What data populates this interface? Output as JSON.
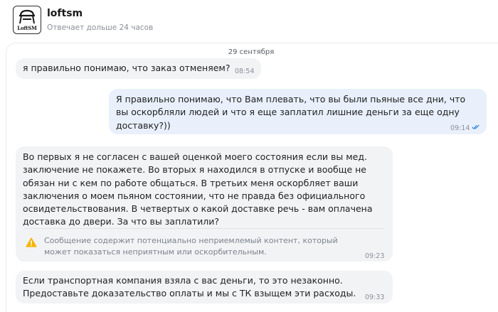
{
  "header": {
    "shop_name": "loftsm",
    "status": "Отвечает дольше 24 часов",
    "avatar_text": "LoftSM",
    "avatar_icon": "chair-icon"
  },
  "chat": {
    "date_separator": "29 сентября",
    "messages": [
      {
        "direction": "in",
        "text": "я правильно понимаю, что заказ отменяем?",
        "time": "08:54"
      },
      {
        "direction": "out",
        "text": "Я правильно понимаю, что Вам плевать, что вы были пьяные все дни, что\nвы оскорбляли людей и что я еще заплатил лишние деньги за еще одну\nдоставку?))",
        "time": "09:14",
        "status_icon": "double-check-icon",
        "status_color": "#2a7de1"
      },
      {
        "direction": "in",
        "text": "Во первых я не согласен с вашей оценкой моего состояния если вы мед.\nзаключение не покажете. Во вторых я находился в отпуске и вообще не\nобязан ни с кем по работе общаться. В третьих меня оскорбляет ваши\nзаключения о моем пьяном состоянии, что не правда без официального\nосвидетельствования. В четвертых о какой доставке речь - вам оплачена\nдоставка до двери. За что вы заплатили?",
        "warning": "Сообщение содержит потенциально неприемлемый контент, который\nможет показаться неприятным или оскорбительным.",
        "warning_icon": "warning-triangle-icon",
        "warning_color": "#f5b400",
        "time": "09:23"
      },
      {
        "direction": "in",
        "text": "Если транспортная компания взяла с вас деньги, то это незаконно.\nПредоставьте доказательство оплаты и мы с ТК взыщем эти расходы.",
        "time": "09:33"
      }
    ]
  }
}
